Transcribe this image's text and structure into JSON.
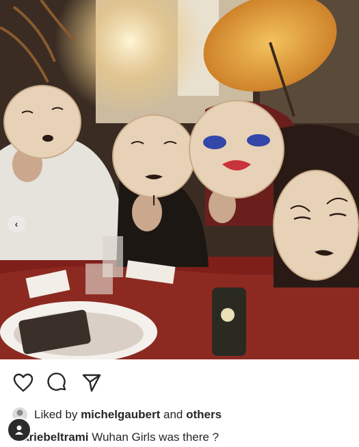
{
  "post": {
    "image_alt": "Group photo of people holding painted mask fans at a dinner table",
    "carousel_prev_glyph": "‹"
  },
  "actions": {
    "like_icon": "heart-icon",
    "comment_icon": "comment-icon",
    "share_icon": "send-icon"
  },
  "likes": {
    "prefix": "Liked by",
    "user": "michelgaubert",
    "joiner": "and",
    "others": "others"
  },
  "caption": {
    "username": "mariebeltrami",
    "text": "Wuhan Girls was there ?"
  },
  "colors": {
    "text": "#262626",
    "background": "#ffffff"
  }
}
